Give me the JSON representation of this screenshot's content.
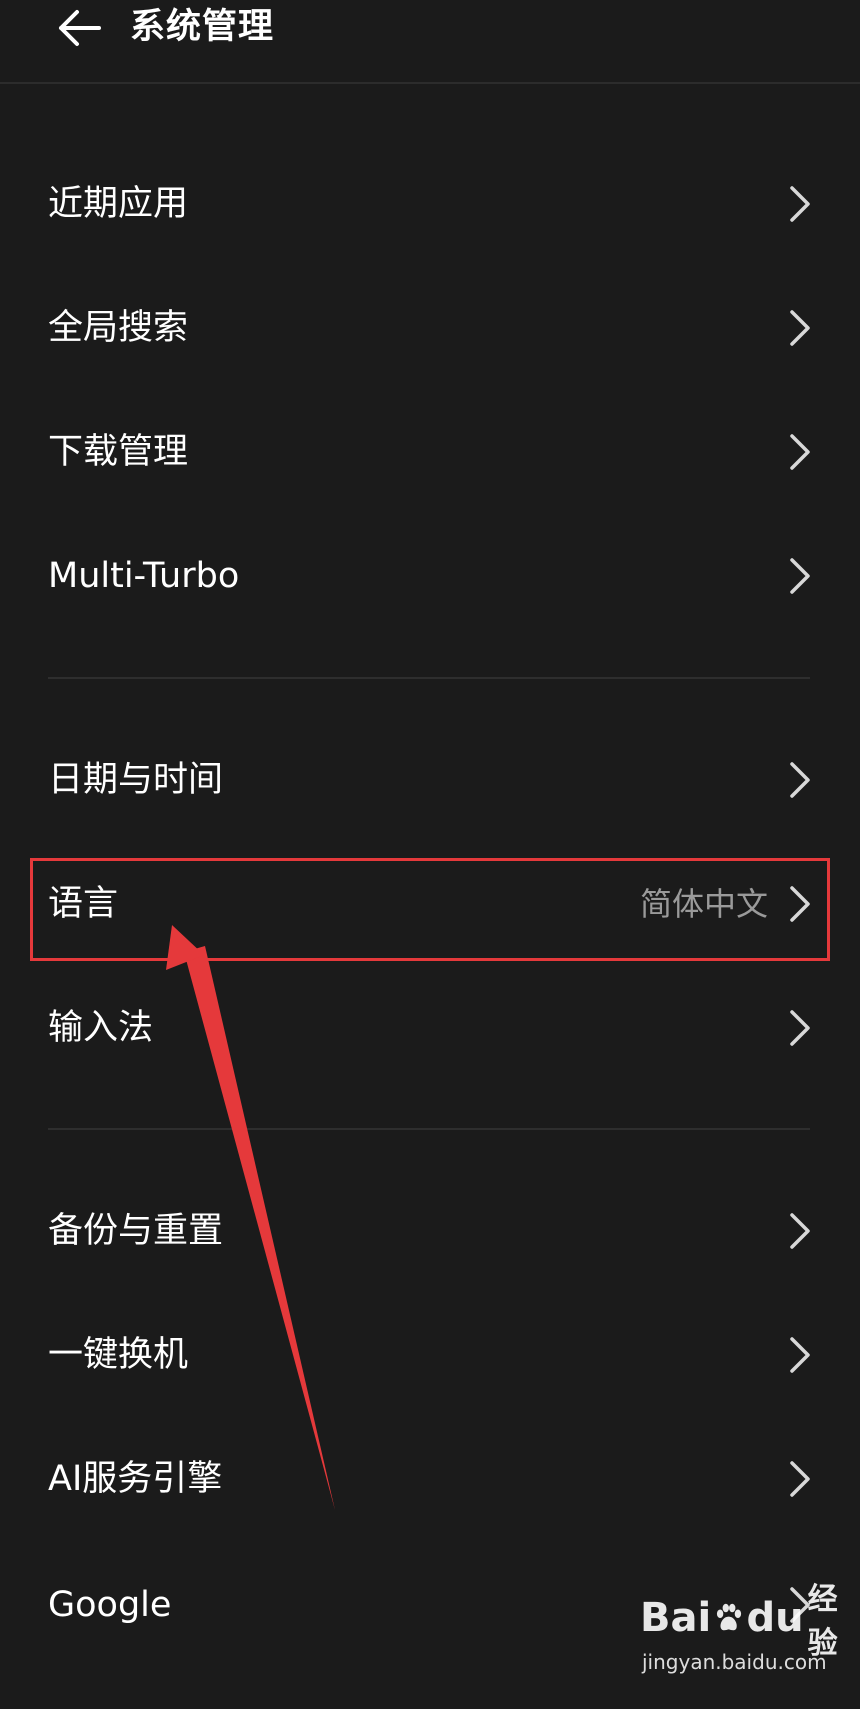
{
  "header": {
    "title": "系统管理"
  },
  "rows": [
    {
      "label": "近期应用",
      "value": ""
    },
    {
      "label": "全局搜索",
      "value": ""
    },
    {
      "label": "下载管理",
      "value": ""
    },
    {
      "label": "Multi-Turbo",
      "value": ""
    },
    {
      "label": "日期与时间",
      "value": ""
    },
    {
      "label": "语言",
      "value": "简体中文"
    },
    {
      "label": "输入法",
      "value": ""
    },
    {
      "label": "备份与重置",
      "value": ""
    },
    {
      "label": "一键换机",
      "value": ""
    },
    {
      "label": "AI服务引擎",
      "value": ""
    },
    {
      "label": "Google",
      "value": ""
    }
  ],
  "annotation": {
    "color": "#e5393b"
  },
  "watermark": {
    "logo_part1": "Bai",
    "logo_part2": "du",
    "logo_suffix": "经验",
    "url": "jingyan.baidu.com"
  },
  "colors": {
    "background": "#1b1b1b",
    "text": "#ffffff",
    "value_text": "#9a9a9a",
    "divider": "#2e2e2e"
  }
}
